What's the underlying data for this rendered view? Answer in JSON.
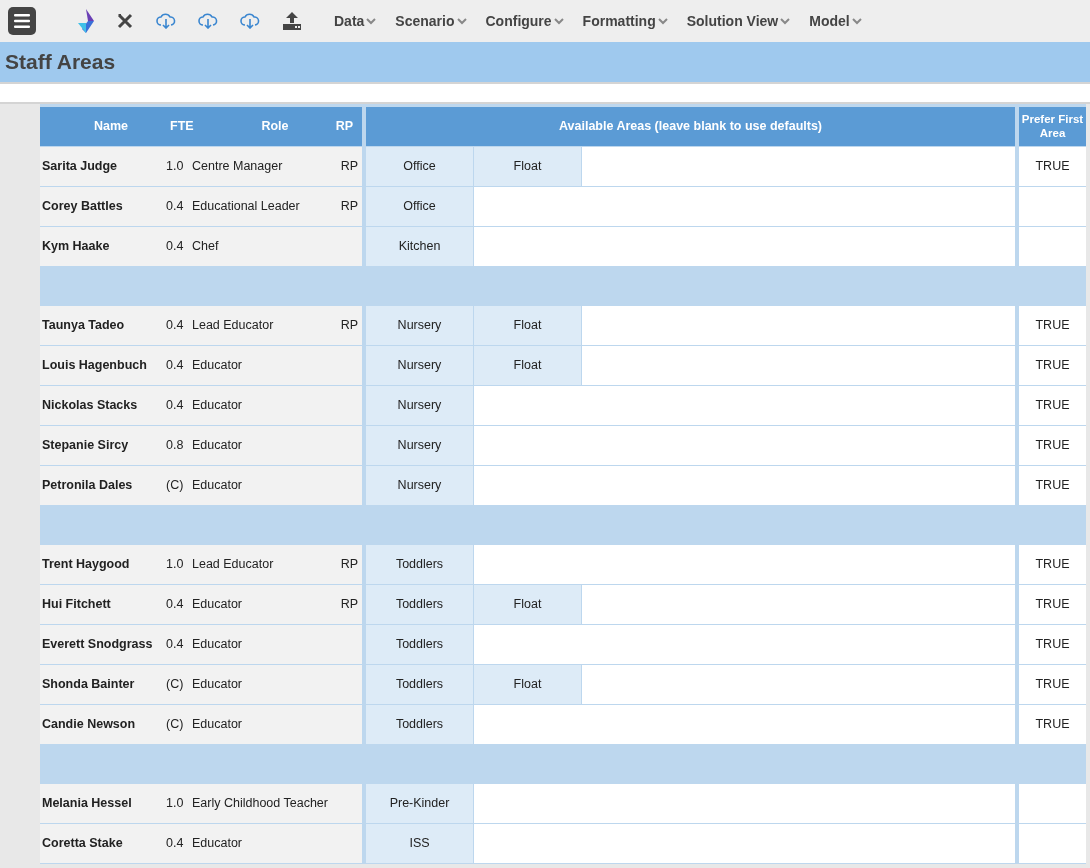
{
  "toolbar": {
    "menus": [
      {
        "label": "Data"
      },
      {
        "label": "Scenario"
      },
      {
        "label": "Configure"
      },
      {
        "label": "Formatting"
      },
      {
        "label": "Solution View"
      },
      {
        "label": "Model"
      }
    ]
  },
  "page": {
    "title": "Staff Areas"
  },
  "table": {
    "columns": {
      "name": "Name",
      "fte": "FTE",
      "role": "Role",
      "rp": "RP",
      "areas": "Available Areas (leave blank to use defaults)",
      "prefer": "Prefer First Area"
    },
    "groups": [
      {
        "rows": [
          {
            "name": "Sarita Judge",
            "fte": "1.0",
            "role": "Centre Manager",
            "rp": "RP",
            "areas": [
              "Office",
              "Float"
            ],
            "prefer": "TRUE"
          },
          {
            "name": "Corey Battles",
            "fte": "0.4",
            "role": "Educational Leader",
            "rp": "RP",
            "areas": [
              "Office"
            ]
          },
          {
            "name": "Kym Haake",
            "fte": "0.4",
            "role": "Chef",
            "areas": [
              "Kitchen"
            ]
          }
        ]
      },
      {
        "rows": [
          {
            "name": "Taunya Tadeo",
            "fte": "0.4",
            "role": "Lead Educator",
            "rp": "RP",
            "areas": [
              "Nursery",
              "Float"
            ],
            "prefer": "TRUE"
          },
          {
            "name": "Louis Hagenbuch",
            "fte": "0.4",
            "role": "Educator",
            "areas": [
              "Nursery",
              "Float"
            ],
            "prefer": "TRUE"
          },
          {
            "name": "Nickolas Stacks",
            "fte": "0.4",
            "role": "Educator",
            "areas": [
              "Nursery"
            ],
            "prefer": "TRUE"
          },
          {
            "name": "Stepanie Sircy",
            "fte": "0.8",
            "role": "Educator",
            "areas": [
              "Nursery"
            ],
            "prefer": "TRUE"
          },
          {
            "name": "Petronila Dales",
            "fte": "(C)",
            "role": "Educator",
            "areas": [
              "Nursery"
            ],
            "prefer": "TRUE"
          }
        ]
      },
      {
        "rows": [
          {
            "name": "Trent Haygood",
            "fte": "1.0",
            "role": "Lead Educator",
            "rp": "RP",
            "areas": [
              "Toddlers"
            ],
            "prefer": "TRUE"
          },
          {
            "name": "Hui Fitchett",
            "fte": "0.4",
            "role": "Educator",
            "rp": "RP",
            "areas": [
              "Toddlers",
              "Float"
            ],
            "prefer": "TRUE"
          },
          {
            "name": "Everett Snodgrass",
            "fte": "0.4",
            "role": "Educator",
            "areas": [
              "Toddlers"
            ],
            "prefer": "TRUE"
          },
          {
            "name": "Shonda Bainter",
            "fte": "(C)",
            "role": "Educator",
            "areas": [
              "Toddlers",
              "Float"
            ],
            "prefer": "TRUE"
          },
          {
            "name": "Candie Newson",
            "fte": "(C)",
            "role": "Educator",
            "areas": [
              "Toddlers"
            ],
            "prefer": "TRUE"
          }
        ]
      },
      {
        "rows": [
          {
            "name": "Melania Hessel",
            "fte": "1.0",
            "role": "Early Childhood Teacher",
            "areas": [
              "Pre-Kinder"
            ]
          },
          {
            "name": "Coretta Stake",
            "fte": "0.4",
            "role": "Educator",
            "areas": [
              "ISS"
            ]
          }
        ]
      }
    ]
  }
}
